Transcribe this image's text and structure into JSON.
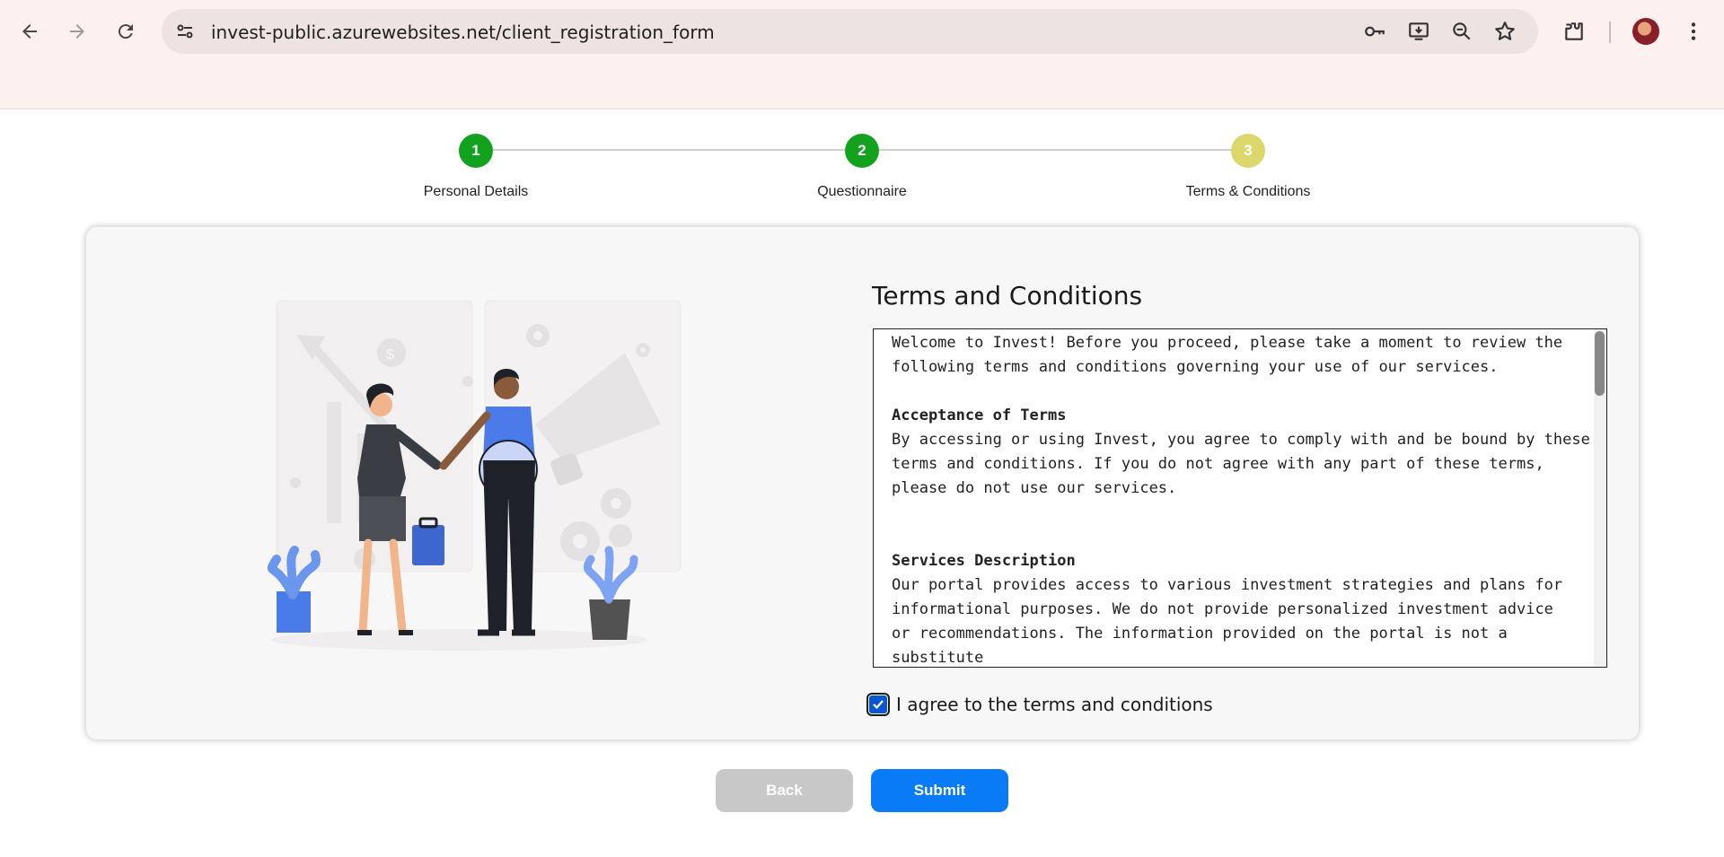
{
  "browser": {
    "url": "invest-public.azurewebsites.net/client_registration_form"
  },
  "stepper": {
    "steps": [
      {
        "number": "1",
        "label": "Personal Details",
        "color": "#12a21d"
      },
      {
        "number": "2",
        "label": "Questionnaire",
        "color": "#12a21d"
      },
      {
        "number": "3",
        "label": "Terms & Conditions",
        "color": "#dbd76a"
      }
    ]
  },
  "terms": {
    "title": "Terms and Conditions",
    "intro": "Welcome to Invest! Before you proceed, please take a moment to review the\nfollowing terms and conditions governing your use of our services.",
    "section1_heading": "Acceptance of Terms",
    "section1_body": "By accessing or using Invest, you agree to comply with and be bound by these\nterms and conditions. If you do not agree with any part of these terms,\nplease do not use our services.",
    "section2_heading": "Services Description",
    "section2_body": "Our portal provides access to various investment strategies and plans for\ninformational purposes. We do not provide personalized investment advice\nor recommendations. The information provided on the portal is not a substitute\nfor professional financial advice.",
    "agree_label": "I agree to the terms and conditions",
    "agree_checked": true
  },
  "actions": {
    "back_label": "Back",
    "submit_label": "Submit"
  },
  "colors": {
    "completed_step": "#12a21d",
    "current_step": "#dbd76a",
    "submit_button": "#0a7bf6",
    "back_button": "#c8c8c8"
  }
}
